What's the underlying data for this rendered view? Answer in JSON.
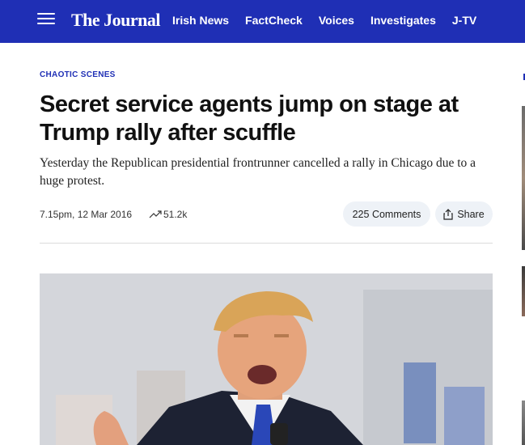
{
  "header": {
    "logo": "The Journal",
    "nav": [
      "Irish News",
      "FactCheck",
      "Voices",
      "Investigates",
      "J-TV"
    ],
    "bar_color": "#1f2fb5"
  },
  "article": {
    "kicker": "CHAOTIC SCENES",
    "headline": "Secret service agents jump on stage at Trump rally after scuffle",
    "standfirst": "Yesterday the Republican presidential frontrunner cancelled a rally in Chicago due to a huge protest.",
    "timestamp": "7.15pm, 12 Mar 2016",
    "views": "51.2k",
    "comments_label": "225 Comments",
    "share_label": "Share"
  },
  "icons": {
    "menu": "hamburger-icon",
    "views": "trending-up-icon",
    "share": "share-icon"
  }
}
